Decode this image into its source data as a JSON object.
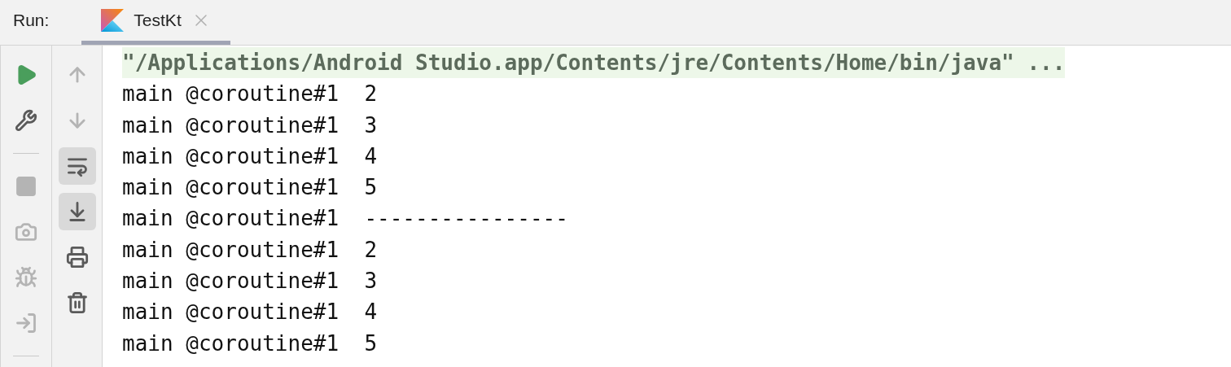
{
  "run_label": "Run:",
  "tabs": [
    {
      "label": "TestKt",
      "selected": true,
      "closable": true
    }
  ],
  "left_toolbar": [
    {
      "kind": "run",
      "disabled": false
    },
    {
      "kind": "settings",
      "disabled": false
    },
    {
      "kind": "separator"
    },
    {
      "kind": "stop",
      "disabled": true
    },
    {
      "kind": "camera",
      "disabled": true
    },
    {
      "kind": "bug",
      "disabled": true
    },
    {
      "kind": "login",
      "disabled": true
    },
    {
      "kind": "separator"
    }
  ],
  "right_toolbar": [
    {
      "kind": "up",
      "disabled": true,
      "selected": false
    },
    {
      "kind": "down",
      "disabled": true,
      "selected": false
    },
    {
      "kind": "wrap",
      "disabled": false,
      "selected": true
    },
    {
      "kind": "scroll_end",
      "disabled": false,
      "selected": true
    },
    {
      "kind": "print",
      "disabled": false,
      "selected": false
    },
    {
      "kind": "trash",
      "disabled": false,
      "selected": false
    }
  ],
  "console_lines": [
    {
      "kind": "command",
      "text": "\"/Applications/Android Studio.app/Contents/jre/Contents/Home/bin/java\" ..."
    },
    {
      "kind": "output",
      "text": "main @coroutine#1  2"
    },
    {
      "kind": "output",
      "text": "main @coroutine#1  3"
    },
    {
      "kind": "output",
      "text": "main @coroutine#1  4"
    },
    {
      "kind": "output",
      "text": "main @coroutine#1  5"
    },
    {
      "kind": "output",
      "text": "main @coroutine#1  ----------------"
    },
    {
      "kind": "output",
      "text": "main @coroutine#1  2"
    },
    {
      "kind": "output",
      "text": "main @coroutine#1  3"
    },
    {
      "kind": "output",
      "text": "main @coroutine#1  4"
    },
    {
      "kind": "output",
      "text": "main @coroutine#1  5"
    }
  ]
}
